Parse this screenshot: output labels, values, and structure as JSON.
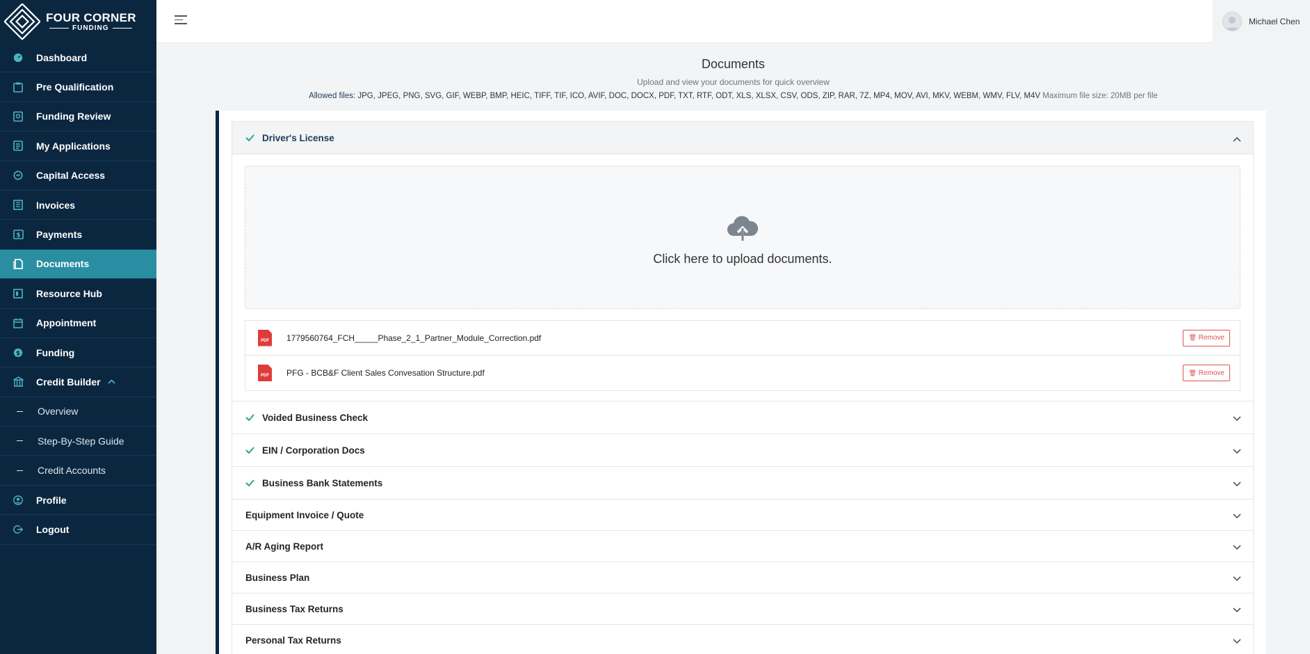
{
  "brand": {
    "line1": "FOUR CORNER",
    "line2": "FUNDING"
  },
  "user": {
    "name": "Michael Chen"
  },
  "sidebar": {
    "items": [
      {
        "label": "Dashboard",
        "icon": "dashboard-icon"
      },
      {
        "label": "Pre Qualification",
        "icon": "clipboard-icon"
      },
      {
        "label": "Funding Review",
        "icon": "review-icon"
      },
      {
        "label": "My Applications",
        "icon": "applications-icon"
      },
      {
        "label": "Capital Access",
        "icon": "capital-icon"
      },
      {
        "label": "Invoices",
        "icon": "invoice-icon"
      },
      {
        "label": "Payments",
        "icon": "payment-icon"
      },
      {
        "label": "Documents",
        "icon": "document-icon",
        "active": true
      },
      {
        "label": "Resource Hub",
        "icon": "resource-icon"
      },
      {
        "label": "Appointment",
        "icon": "calendar-icon"
      },
      {
        "label": "Funding",
        "icon": "dollar-icon"
      },
      {
        "label": "Credit Builder",
        "icon": "bank-icon",
        "expanded": true
      }
    ],
    "sub_items": [
      "Overview",
      "Step-By-Step Guide",
      "Credit Accounts"
    ],
    "bottom_items": [
      {
        "label": "Profile",
        "icon": "user-circle-icon"
      },
      {
        "label": "Logout",
        "icon": "logout-icon"
      }
    ]
  },
  "page": {
    "title": "Documents",
    "subtitle": "Upload and view your documents for quick overview",
    "allowed_label": "Allowed files:",
    "allowed_types": "JPG, JPEG, PNG, SVG, GIF, WEBP, BMP, HEIC, TIFF, TIF, ICO, AVIF, DOC, DOCX, PDF, TXT, RTF, ODT, XLS, XLSX, CSV, ODS, ZIP, RAR, 7Z, MP4, MOV, AVI, MKV, WEBM, WMV, FLV, M4V",
    "max_size": "Maximum file size: 20MB per file"
  },
  "upload": {
    "prompt": "Click here to upload documents."
  },
  "files": [
    {
      "name": "1779560764_FCH_____Phase_2_1_Partner_Module_Correction.pdf",
      "badge": "PDF",
      "remove_label": "Remove"
    },
    {
      "name": "PFG - BCB&F Client Sales Convesation Structure.pdf",
      "badge": "PDF",
      "remove_label": "Remove"
    }
  ],
  "sections": [
    {
      "title": "Driver's License",
      "complete": true,
      "open": true
    },
    {
      "title": "Voided Business Check",
      "complete": true
    },
    {
      "title": "EIN / Corporation Docs",
      "complete": true
    },
    {
      "title": "Business Bank Statements",
      "complete": true
    },
    {
      "title": "Equipment Invoice / Quote",
      "complete": false
    },
    {
      "title": "A/R Aging Report",
      "complete": false
    },
    {
      "title": "Business Plan",
      "complete": false
    },
    {
      "title": "Business Tax Returns",
      "complete": false
    },
    {
      "title": "Personal Tax Returns",
      "complete": false
    }
  ],
  "colors": {
    "sidebar": "#0b2740",
    "accent": "#2a8ea3",
    "success": "#2aa58b",
    "danger": "#e05252"
  }
}
